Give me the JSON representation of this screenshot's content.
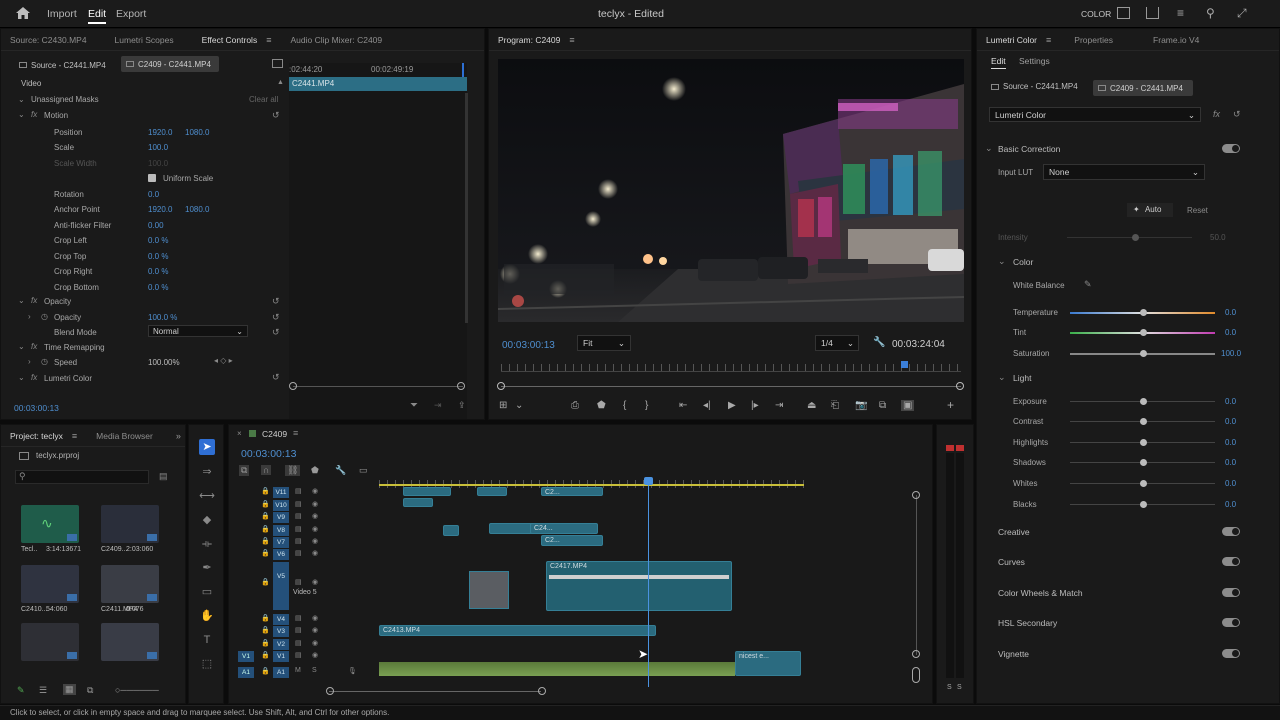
{
  "topbar": {
    "nav": [
      "Import",
      "Edit",
      "Export"
    ],
    "active_nav": "Edit",
    "title": "teclyx - Edited",
    "workspace": "COLOR"
  },
  "source_panel": {
    "tabs": [
      "Source: C2430.MP4",
      "Lumetri Scopes",
      "Effect Controls",
      "Audio Clip Mixer: C2409"
    ],
    "active_tab": "Effect Controls",
    "source_chip": "Source - C2441.MP4",
    "seq_chip": "C2409 - C2441.MP4",
    "ruler_times": [
      ":02:44:20",
      "00:02:49:19"
    ],
    "clip_name": "C2441.MP4",
    "video_header": "Video",
    "unassigned_masks": "Unassigned Masks",
    "clear_all": "Clear all",
    "motion": "Motion",
    "rows": [
      {
        "label": "Position",
        "v1": "1920.0",
        "v2": "1080.0"
      },
      {
        "label": "Scale",
        "v1": "100.0",
        "v2": ""
      },
      {
        "label": "Scale Width",
        "v1": "100.0",
        "v2": ""
      },
      {
        "label": "Uniform Scale",
        "v1": "",
        "v2": ""
      },
      {
        "label": "Rotation",
        "v1": "0.0",
        "v2": ""
      },
      {
        "label": "Anchor Point",
        "v1": "1920.0",
        "v2": "1080.0"
      },
      {
        "label": "Anti-flicker Filter",
        "v1": "0.00",
        "v2": ""
      },
      {
        "label": "Crop Left",
        "v1": "0.0 %",
        "v2": ""
      },
      {
        "label": "Crop Top",
        "v1": "0.0 %",
        "v2": ""
      },
      {
        "label": "Crop Right",
        "v1": "0.0 %",
        "v2": ""
      },
      {
        "label": "Crop Bottom",
        "v1": "0.0 %",
        "v2": ""
      }
    ],
    "opacity_header": "Opacity",
    "opacity_label": "Opacity",
    "opacity_value": "100.0 %",
    "blend_label": "Blend Mode",
    "blend_value": "Normal",
    "time_remap": "Time Remapping",
    "speed_label": "Speed",
    "speed_value": "100.00%",
    "lumetri": "Lumetri Color",
    "timecode": "00:03:00:13"
  },
  "program": {
    "title": "Program: C2409",
    "timecode": "00:03:00:13",
    "fit": "Fit",
    "quality": "1/4",
    "duration": "00:03:24:04"
  },
  "lumetri": {
    "tabs": [
      "Lumetri Color",
      "Properties",
      "Frame.io V4"
    ],
    "subtabs": [
      "Edit",
      "Settings"
    ],
    "source_chip": "Source - C2441.MP4",
    "seq_chip": "C2409 - C2441.MP4",
    "effect": "Lumetri Color",
    "basic_correction": "Basic Correction",
    "input_lut_label": "Input LUT",
    "input_lut_value": "None",
    "auto": "Auto",
    "reset": "Reset",
    "intensity": "Intensity",
    "intensity_value": "50.0",
    "color_header": "Color",
    "white_balance": "White Balance",
    "color_rows": [
      {
        "label": "Temperature",
        "value": "0.0"
      },
      {
        "label": "Tint",
        "value": "0.0"
      },
      {
        "label": "Saturation",
        "value": "100.0"
      }
    ],
    "light_header": "Light",
    "light_rows": [
      {
        "label": "Exposure",
        "value": "0.0"
      },
      {
        "label": "Contrast",
        "value": "0.0"
      },
      {
        "label": "Highlights",
        "value": "0.0"
      },
      {
        "label": "Shadows",
        "value": "0.0"
      },
      {
        "label": "Whites",
        "value": "0.0"
      },
      {
        "label": "Blacks",
        "value": "0.0"
      }
    ],
    "sections": [
      "Creative",
      "Curves",
      "Color Wheels & Match",
      "HSL Secondary",
      "Vignette"
    ]
  },
  "project": {
    "tabs": [
      "Project: teclyx",
      "Media Browser"
    ],
    "file": "teclyx.prproj",
    "items": [
      {
        "name": "Tecl..",
        "dur": "3:14:13671"
      },
      {
        "name": "C2409...",
        "dur": "2:03:060"
      },
      {
        "name": "C2410...",
        "dur": "54:060"
      },
      {
        "name": "C2411.MP4",
        "dur": "0:076"
      },
      {
        "name": "",
        "dur": ""
      },
      {
        "name": "",
        "dur": ""
      }
    ]
  },
  "timeline": {
    "title": "C2409",
    "timecode": "00:03:00:13",
    "tracks": [
      "V11",
      "V10",
      "V9",
      "V8",
      "V7",
      "V6",
      "V5",
      "V4",
      "V3",
      "V2",
      "V1",
      "A1"
    ],
    "v5_label": "Video 5",
    "clips": {
      "c2417": "C2417.MP4",
      "c2413": "C2413.MP4",
      "c24": "C24...",
      "c2": "C2...",
      "nicest": "nicest e..."
    }
  },
  "meter": {
    "labels": [
      "S",
      "S"
    ]
  },
  "status": "Click to select, or click in empty space and drag to marquee select. Use Shift, Alt, and Ctrl for other options."
}
